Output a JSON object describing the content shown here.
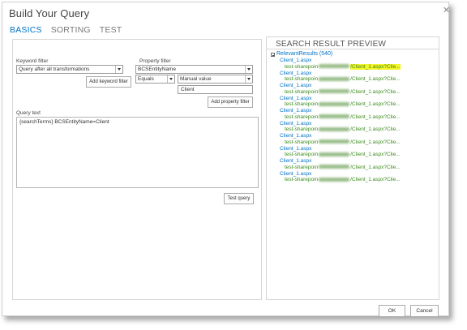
{
  "dialog": {
    "title": "Build Your Query",
    "close_glyph": "✕",
    "tabs": [
      {
        "label": "BASICS",
        "active": true
      },
      {
        "label": "SORTING",
        "active": false
      },
      {
        "label": "TEST",
        "active": false
      }
    ]
  },
  "keyword_filter": {
    "label": "Keyword filter",
    "selected": "Query after all transformations",
    "button": "Add keyword filter"
  },
  "property_filter": {
    "label": "Property filter",
    "property_selected": "BCSEntityName",
    "operator_selected": "Equals",
    "value_mode_selected": "Manual value",
    "value": "Client",
    "button": "Add property filter"
  },
  "query_text": {
    "label": "Query text",
    "value": "{searchTerms} BCSEntityName=Client",
    "test_button": "Test query"
  },
  "preview": {
    "title": "SEARCH RESULT PREVIEW",
    "group_label": "RelevantResults (540)",
    "results": [
      {
        "title": "Client_1.aspx",
        "url_prefix": "test-sharepoin",
        "url_suffix": "/Client_1.aspx?Clie...",
        "highlight": true
      },
      {
        "title": "Client_1.aspx",
        "url_prefix": "test-sharepoin",
        "url_suffix": "/Client_1.aspx?Clie...",
        "highlight": false
      },
      {
        "title": "Client_1.aspx",
        "url_prefix": "test-sharepoin",
        "url_suffix": "/Client_1.aspx?Clie...",
        "highlight": false
      },
      {
        "title": "Client_1.aspx",
        "url_prefix": "test-sharepoin",
        "url_suffix": "/Client_1.aspx?Clie...",
        "highlight": false
      },
      {
        "title": "Client_1.aspx",
        "url_prefix": "test-sharepoin",
        "url_suffix": "/Client_1.aspx?Clie...",
        "highlight": false
      },
      {
        "title": "Client_1.aspx",
        "url_prefix": "test-sharepoin",
        "url_suffix": "/Client_1.aspx?Clie...",
        "highlight": false
      },
      {
        "title": "Client_1.aspx",
        "url_prefix": "test-sharepoin",
        "url_suffix": "/Client_1.aspx?Clie...",
        "highlight": false
      },
      {
        "title": "Client_1.aspx",
        "url_prefix": "test-sharepoin",
        "url_suffix": "/Client_1.aspx?Clie...",
        "highlight": false
      },
      {
        "title": "Client_1.aspx",
        "url_prefix": "test-sharepoin",
        "url_suffix": "/Client_1.aspx?Clie...",
        "highlight": false
      },
      {
        "title": "Client_1.aspx",
        "url_prefix": "test-sharepoin",
        "url_suffix": "/Client_1.aspx?Clie...",
        "highlight": false
      }
    ]
  },
  "footer": {
    "ok": "OK",
    "cancel": "Cancel"
  },
  "colors": {
    "accent": "#0072c6",
    "url_green": "#3c8c1c",
    "highlight": "#f4f42a"
  }
}
